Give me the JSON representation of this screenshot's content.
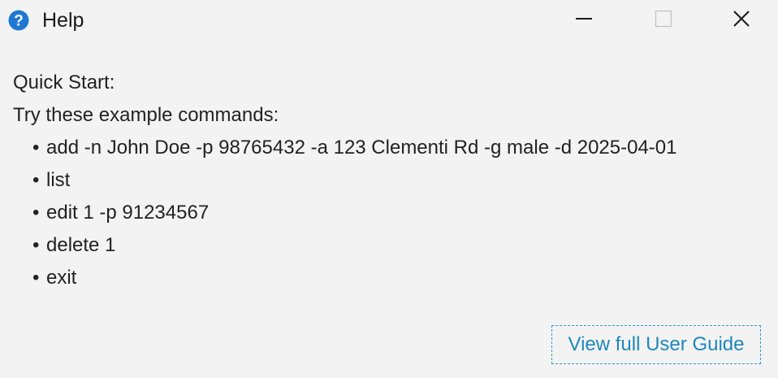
{
  "window": {
    "title": "Help",
    "app_icon": "question-mark-icon",
    "controls": {
      "minimize": "minimize-icon",
      "maximize": "maximize-icon",
      "close": "close-icon"
    }
  },
  "content": {
    "heading": "Quick Start:",
    "intro": "Try these example commands:",
    "bullet": "•",
    "commands": [
      "add -n John Doe -p 98765432 -a 123 Clementi Rd -g male -d 2025-04-01",
      "list",
      "edit 1 -p 91234567",
      "delete 1",
      "exit"
    ]
  },
  "footer": {
    "guide_link": "View full User Guide"
  },
  "colors": {
    "background": "#f3f3f3",
    "link": "#1f88b8",
    "icon_blue": "#1e78d2"
  }
}
